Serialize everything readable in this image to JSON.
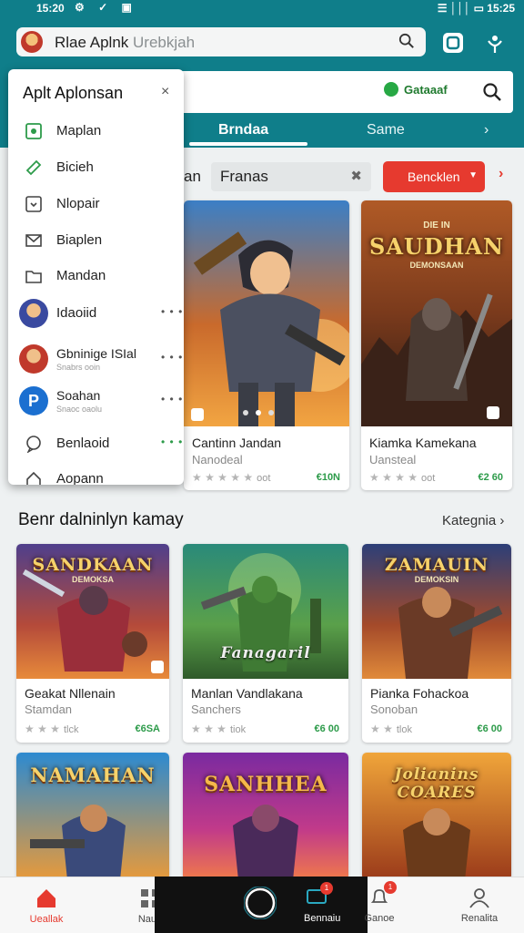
{
  "status": {
    "time": "15:20",
    "icons": "⚙ ✓ ▣",
    "right": "☰ │││ ▭ 15:25"
  },
  "header": {
    "search_title": "Rlae Aplnk",
    "search_placeholder": "Urebkjah",
    "badge_label": "Gataaaf",
    "tabs": [
      {
        "label": "Brndaa"
      },
      {
        "label": "Same"
      },
      {
        "label": "›"
      }
    ]
  },
  "filter": {
    "chip_label": "Franas",
    "chip_prefix": "an",
    "button_label": "Bencklen",
    "chevron": "›"
  },
  "drawer": {
    "title": "Aplt Aplonsan",
    "close": "×",
    "items": [
      {
        "label": "Maplan",
        "icon": "grid-icon"
      },
      {
        "label": "Bicieh",
        "icon": "tag-icon"
      },
      {
        "label": "Nlopair",
        "icon": "download-icon"
      },
      {
        "label": "Biaplen",
        "icon": "mail-icon"
      },
      {
        "label": "Mandan",
        "icon": "folder-icon"
      },
      {
        "label": "Idaoiid",
        "icon": "avatar",
        "more": "• • •"
      },
      {
        "label": "Gbninige ISIal",
        "sub": "Snabrs ooin",
        "icon": "avatar",
        "more": "• • •"
      },
      {
        "label": "Soahan",
        "sub": "Snaoc oaolu",
        "icon": "avatar",
        "more": "• • •"
      },
      {
        "label": "Benlaoid",
        "icon": "chat-icon",
        "more": "• • •"
      },
      {
        "label": "Aopann",
        "icon": "home-icon"
      }
    ]
  },
  "featured": [
    {
      "title": "Cantinn Jandan",
      "sub": "Nanodeal",
      "stars": "★ ★ ★ ★ ★",
      "rating_label": "oot",
      "price": "€10N"
    },
    {
      "title": "Kiamka Kamekana",
      "sub": "Uansteal",
      "stars": "★ ★ ★ ★",
      "rating_label": "oot",
      "price": "€2 60",
      "art_title": "SAUDHAN",
      "art_top": "DIE IN",
      "art_sub": "DEMONSAAN"
    }
  ],
  "section": {
    "title": "Benr dalninlyn kamay",
    "link": "Kategnia ›"
  },
  "grid": [
    {
      "title": "Geakat Nllenain",
      "sub": "Stamdan",
      "stars": "★ ★ ★",
      "rating_label": "tlck",
      "price": "€6SA",
      "art_title": "SANDKAAN",
      "art_sub": "DEMOKSA"
    },
    {
      "title": "Manlan Vandlakana",
      "sub": "Sanchers",
      "stars": "★ ★ ★",
      "rating_label": "tiok",
      "price": "€6 00",
      "art_title": "Fanagaril"
    },
    {
      "title": "Pianka Fohackoa",
      "sub": "Sonoban",
      "stars": "★ ★",
      "rating_label": "tlok",
      "price": "€6 00",
      "art_title": "ZAMAUIN",
      "art_sub": "DEMOKSIN"
    },
    {
      "art_title": "NAMAHAN"
    },
    {
      "art_title": "SANHHEA"
    },
    {
      "art_title": "Jolianins COARES"
    }
  ],
  "bottomnav": [
    {
      "label": "Ueallak",
      "icon": "home-icon"
    },
    {
      "label": "Naua",
      "icon": "grid-icon"
    },
    {
      "label": "",
      "icon": "circle-icon"
    },
    {
      "label": "Bennaiu",
      "icon": "chat-icon",
      "badge": "1"
    },
    {
      "label": "Ganoe",
      "icon": "bell-icon",
      "badge": "1"
    },
    {
      "label": "Renalita",
      "icon": "profile-icon"
    }
  ]
}
